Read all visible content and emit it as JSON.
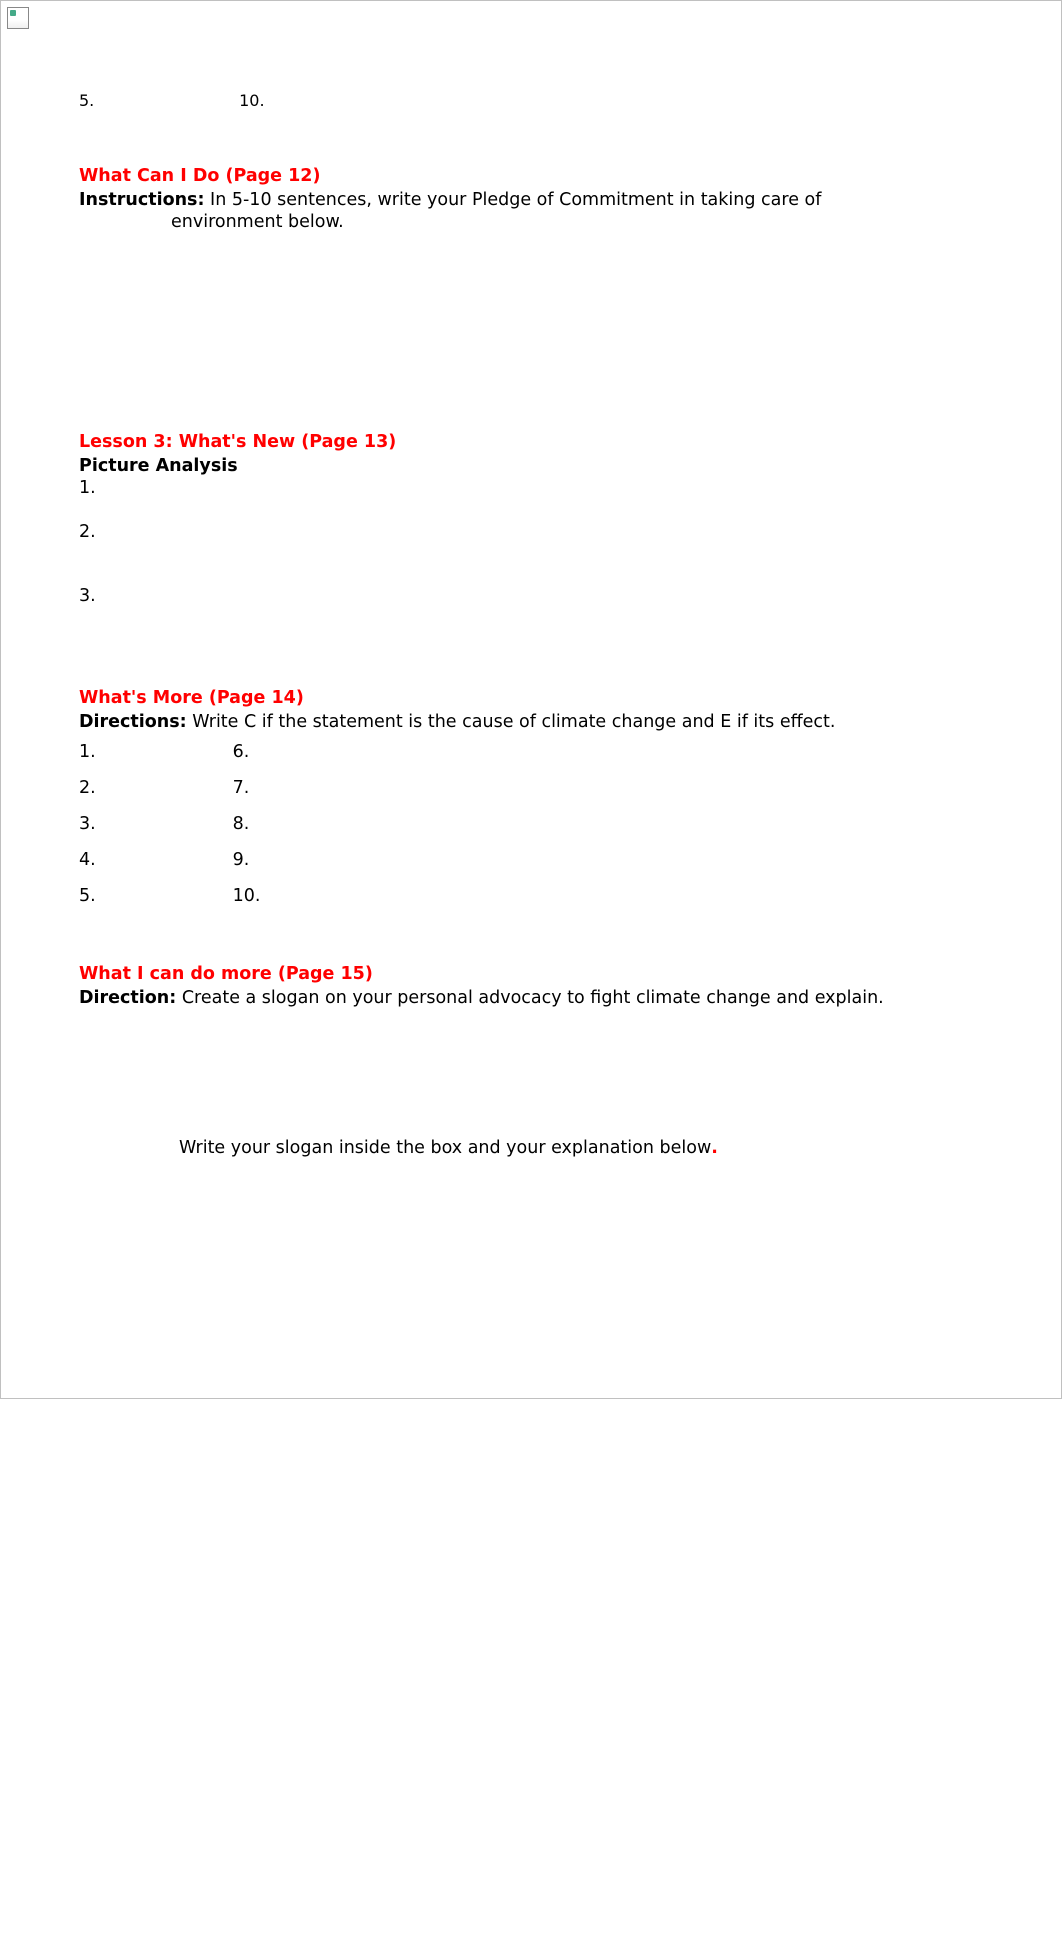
{
  "top_row": {
    "left": "5.",
    "right": "10."
  },
  "section1": {
    "heading": "What Can I Do (Page 12)",
    "label": "Instructions:",
    "text_line1": " In 5-10 sentences, write your Pledge of Commitment in taking care of",
    "text_line2": "environment below."
  },
  "section2": {
    "heading": "Lesson 3: What's New (Page 13)",
    "subheading": "Picture Analysis",
    "items": [
      "1.",
      "2.",
      "3."
    ]
  },
  "section3": {
    "heading": "What's More (Page 14)",
    "label": "Directions:",
    "text": " Write C if the statement is the cause of climate change and E if its effect.",
    "rows": [
      {
        "left": "1.",
        "right": "6."
      },
      {
        "left": "2.",
        "right": "7."
      },
      {
        "left": "3.",
        "right": "8."
      },
      {
        "left": "4.",
        "right": "9."
      },
      {
        "left": "5.",
        "right": "10."
      }
    ]
  },
  "section4": {
    "heading": "What I can do more (Page 15)",
    "label": "Direction:",
    "text": " Create a slogan on your personal advocacy to fight climate change and explain.",
    "slogan_instruction": "Write your slogan inside the box and your explanation below",
    "period": "."
  }
}
